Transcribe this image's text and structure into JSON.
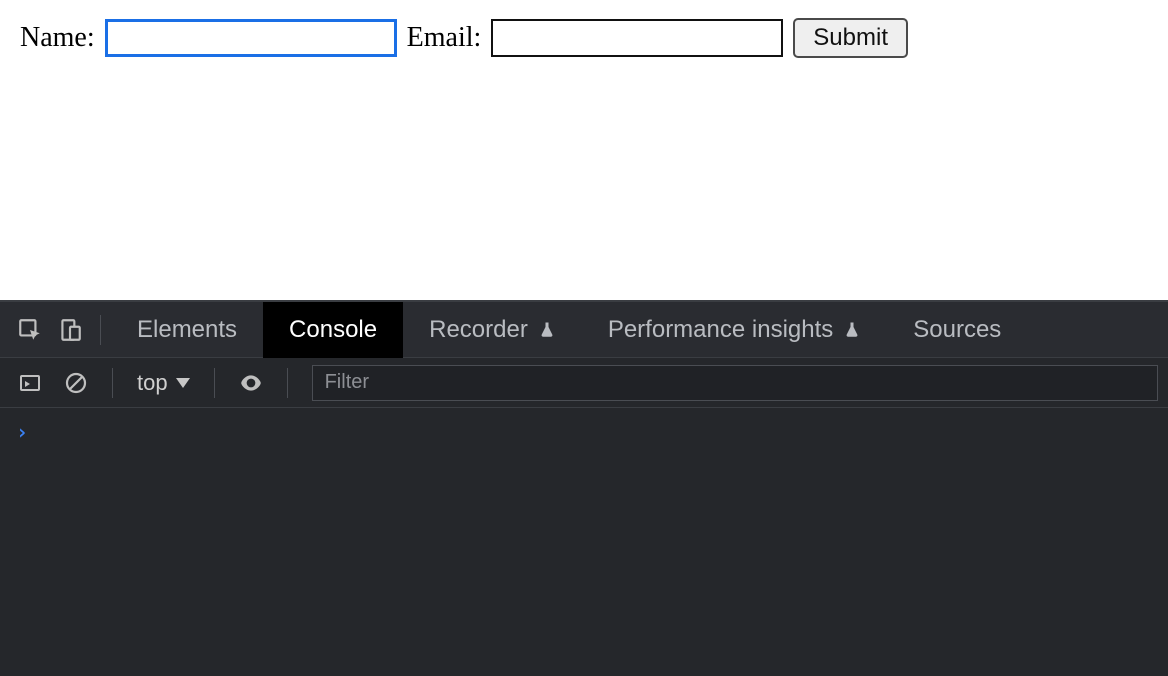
{
  "form": {
    "name_label": "Name:",
    "email_label": "Email:",
    "name_value": "",
    "email_value": "",
    "submit_label": "Submit"
  },
  "devtools": {
    "tabs": {
      "elements": "Elements",
      "console": "Console",
      "recorder": "Recorder",
      "performance_insights": "Performance insights",
      "sources": "Sources"
    },
    "console_toolbar": {
      "context_label": "top",
      "filter_placeholder": "Filter"
    },
    "prompt_symbol": "›"
  }
}
